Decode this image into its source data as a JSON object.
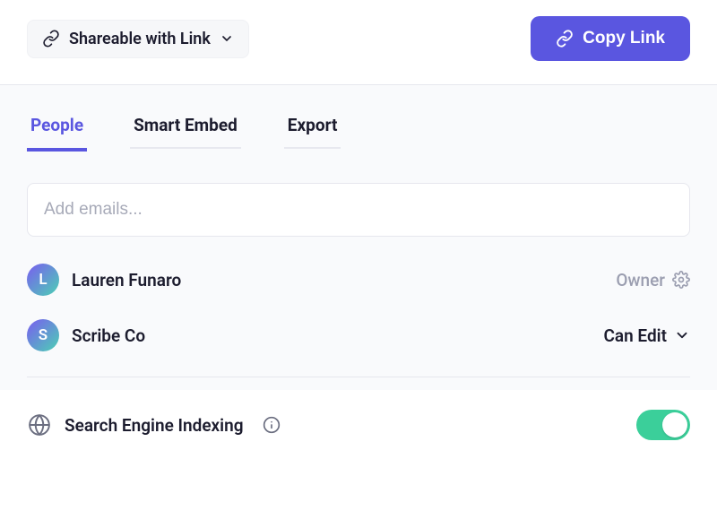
{
  "header": {
    "share_mode_label": "Shareable with Link",
    "copy_button_label": "Copy Link"
  },
  "tabs": [
    {
      "label": "People",
      "active": true
    },
    {
      "label": "Smart Embed",
      "active": false
    },
    {
      "label": "Export",
      "active": false
    }
  ],
  "email_input": {
    "placeholder": "Add emails..."
  },
  "members": [
    {
      "initial": "L",
      "name": "Lauren Funaro",
      "role_label": "Owner",
      "role_type": "owner"
    },
    {
      "initial": "S",
      "name": "Scribe Co",
      "role_label": "Can Edit",
      "role_type": "editable"
    }
  ],
  "search_index": {
    "label": "Search Engine Indexing",
    "enabled": true
  },
  "colors": {
    "accent": "#5a56e0",
    "toggle_on": "#3bcf9a"
  }
}
